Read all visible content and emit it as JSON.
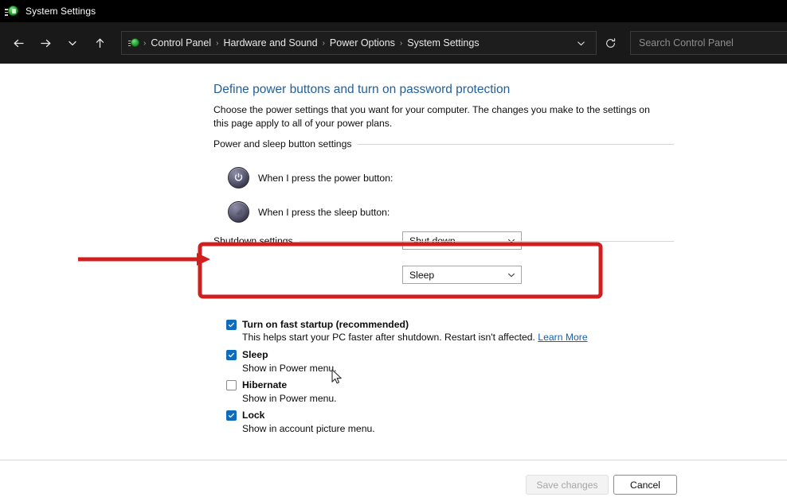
{
  "window": {
    "title": "System Settings",
    "app_icon": "system-settings-icon"
  },
  "toolbar": {
    "back_icon": "back-arrow-icon",
    "forward_icon": "forward-arrow-icon",
    "recent_icon": "chevron-down-icon",
    "up_icon": "up-arrow-icon",
    "dropdown_icon": "chevron-down-icon",
    "refresh_icon": "refresh-icon",
    "breadcrumb": [
      "Control Panel",
      "Hardware and Sound",
      "Power Options",
      "System Settings"
    ],
    "separator": "›"
  },
  "search": {
    "placeholder": "Search Control Panel",
    "value": ""
  },
  "page": {
    "title": "Define power buttons and turn on password protection",
    "description": "Choose the power settings that you want for your computer. The changes you make to the settings on this page apply to all of your power plans."
  },
  "power_section": {
    "heading": "Power and sleep button settings",
    "rows": [
      {
        "icon": "power-button-icon",
        "label": "When I press the power button:",
        "value": "Shut down"
      },
      {
        "icon": "sleep-moon-icon",
        "label": "When I press the sleep button:",
        "value": "Sleep"
      }
    ]
  },
  "shutdown_section": {
    "heading": "Shutdown settings",
    "items": [
      {
        "label": "Turn on fast startup (recommended)",
        "checked": true,
        "sub": "This helps start your PC faster after shutdown. Restart isn't affected.",
        "link": "Learn More"
      },
      {
        "label": "Sleep",
        "checked": true,
        "sub": "Show in Power menu."
      },
      {
        "label": "Hibernate",
        "checked": false,
        "sub": "Show in Power menu."
      },
      {
        "label": "Lock",
        "checked": true,
        "sub": "Show in account picture menu."
      }
    ]
  },
  "footer": {
    "save_label": "Save changes",
    "save_disabled": true,
    "cancel_label": "Cancel"
  },
  "annotation": {
    "color": "#d11f1f",
    "arrow_icon": "red-arrow-icon",
    "highlight_icon": "red-highlight-box"
  },
  "cursor": {
    "icon": "mouse-pointer-icon"
  }
}
